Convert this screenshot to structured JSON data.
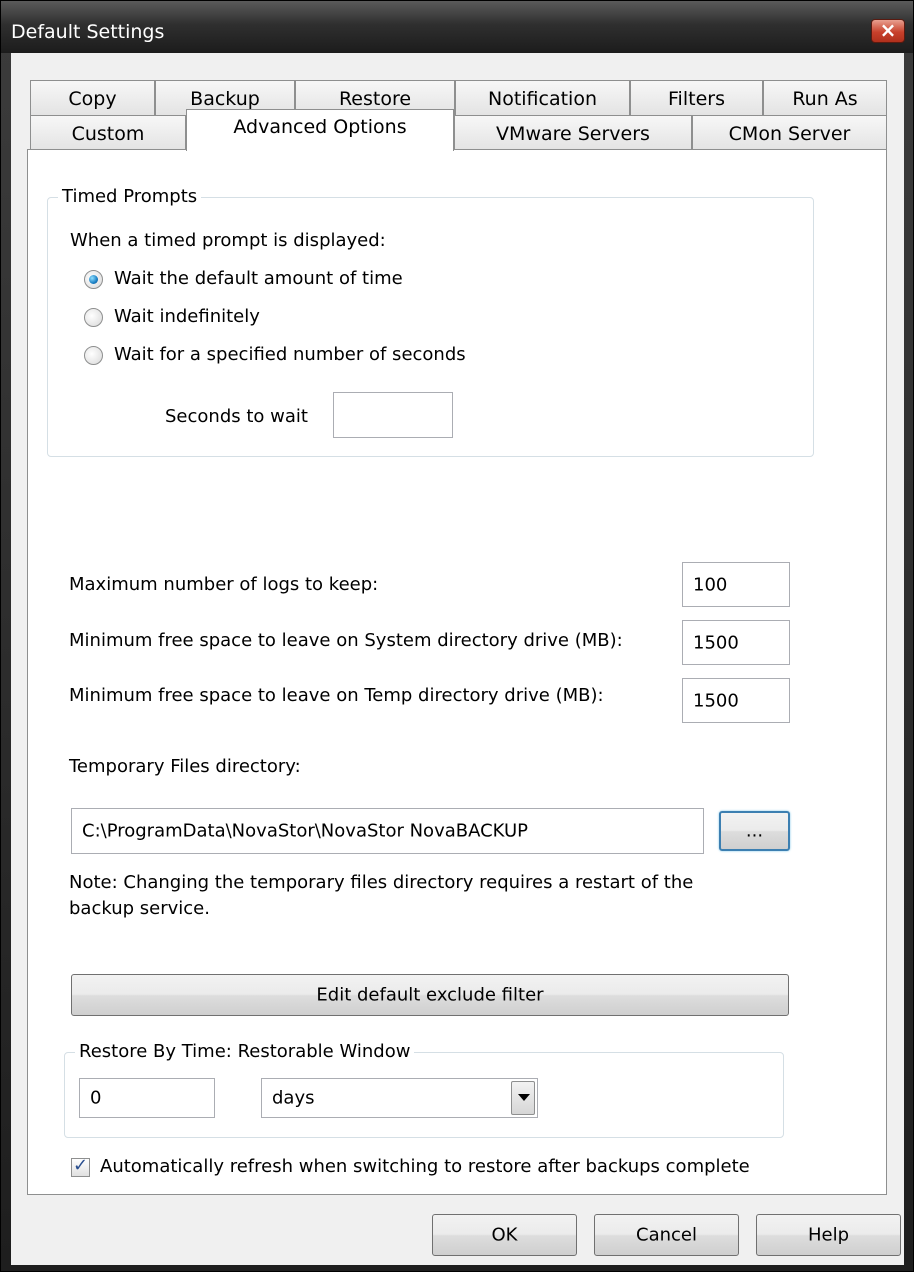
{
  "window": {
    "title": "Default Settings"
  },
  "tabs_row1": [
    {
      "label": "Copy"
    },
    {
      "label": "Backup"
    },
    {
      "label": "Restore"
    },
    {
      "label": "Notification"
    },
    {
      "label": "Filters"
    },
    {
      "label": "Run As"
    }
  ],
  "tabs_row2": [
    {
      "label": "Custom"
    },
    {
      "label": "Advanced Options",
      "active": true
    },
    {
      "label": "VMware Servers"
    },
    {
      "label": "CMon Server"
    }
  ],
  "timed_prompts": {
    "group_title": "Timed Prompts",
    "intro": "When a timed prompt is displayed:",
    "options": [
      {
        "label": "Wait the default amount of time",
        "checked": true
      },
      {
        "label": "Wait indefinitely",
        "checked": false
      },
      {
        "label": "Wait for a specified number of seconds",
        "checked": false
      }
    ],
    "seconds_label": "Seconds to wait",
    "seconds_value": ""
  },
  "settings": {
    "max_logs_label": "Maximum number of logs to keep:",
    "max_logs_value": "100",
    "min_system_label": "Minimum free space to leave on System directory drive (MB):",
    "min_system_value": "1500",
    "min_temp_label": "Minimum free space to leave on Temp directory drive (MB):",
    "min_temp_value": "1500",
    "temp_dir_label": "Temporary Files directory:",
    "temp_dir_value": "C:\\ProgramData\\NovaStor\\NovaStor NovaBACKUP",
    "browse_label": "...",
    "note_line1": "Note: Changing the temporary files directory requires a restart of the",
    "note_line2": "backup service.",
    "exclude_filter_label": "Edit default exclude filter"
  },
  "restore_by_time": {
    "group_title": "Restore By Time: Restorable Window",
    "value": "0",
    "unit": "days"
  },
  "auto_refresh": {
    "label": "Automatically refresh when switching to restore after backups complete",
    "checked": true,
    "check_glyph": "✓"
  },
  "buttons": {
    "ok": "OK",
    "cancel": "Cancel",
    "help": "Help"
  },
  "icons": {
    "close": "×"
  }
}
